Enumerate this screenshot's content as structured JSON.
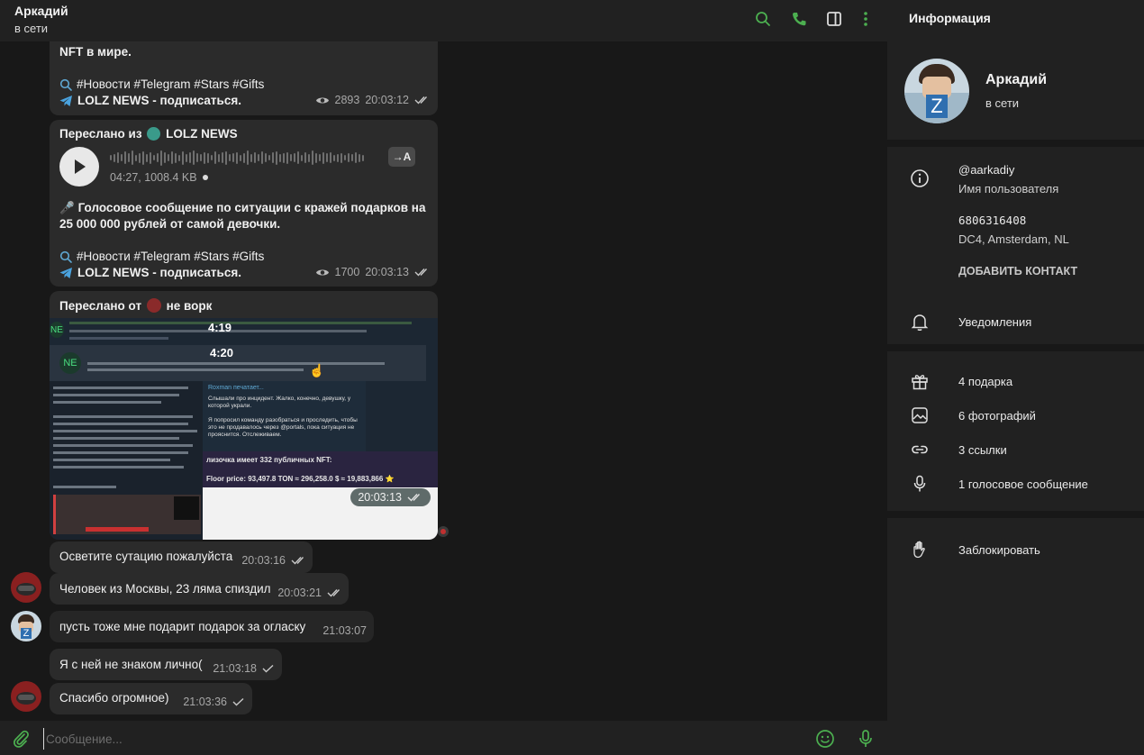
{
  "header": {
    "name": "Аркадий",
    "status": "в сети",
    "icons": [
      "search-icon",
      "phone-icon",
      "sidebar-toggle-icon",
      "more-vertical-icon"
    ]
  },
  "messages": {
    "m1": {
      "text_top": "NFT в мире.",
      "hashtags": "#Новости #Telegram #Stars #Gifts",
      "link": "LOLZ NEWS - подписаться.",
      "views": "2893",
      "time": "20:03:12"
    },
    "m2": {
      "forward_prefix": "Переслано из",
      "forward_source": "LOLZ NEWS",
      "voice_meta": "04:27, 1008.4 KB",
      "transcribe": "→A",
      "text_line1": "Голосовое сообщение по ситуации с кражей подарков на",
      "text_line2": "25 000 000 рублей от самой девочки.",
      "hashtags": "#Новости #Telegram #Stars #Gifts",
      "link": "LOLZ NEWS - подписаться.",
      "views": "1700",
      "time": "20:03:13"
    },
    "m3": {
      "forward_prefix": "Переслано от",
      "forward_source": "не ворк",
      "time": "20:03:13",
      "image": {
        "time1": "4:19",
        "time2": "4:20",
        "card_title": "Roxman печатает...",
        "card_body1": "Слышали про инцидент. Жалко, конечно, девушку, у которой украли.",
        "card_body2": "Я попросил команду разобраться и проследить, чтобы это не продавалось через @portals, пока ситуация не прояснится. Отслеживаем.",
        "nft_line1": "лизочка имеет 332 публичных NFT:",
        "nft_line2": "Floor price: 93,497.8 TON ≈ 296,258.0 $ ≈ 19,883,866 ⭐"
      }
    },
    "m4": {
      "text": "Осветите сутацию пожалуйста",
      "time": "20:03:16"
    },
    "m5": {
      "text": "Человек из Москвы, 23 ляма спиздил",
      "time": "20:03:21"
    },
    "m6": {
      "text": "пусть тоже  мне подарит подарок  за огласку",
      "time": "21:03:07"
    },
    "m7": {
      "text": "Я с ней не знаком лично(",
      "time": "21:03:18"
    },
    "m8": {
      "text": "Спасибо огромное)",
      "time": "21:03:36"
    }
  },
  "composer": {
    "placeholder": "Сообщение..."
  },
  "info": {
    "title": "Информация",
    "name": "Аркадий",
    "status": "в сети",
    "username": "@aarkadiy",
    "username_label": "Имя пользователя",
    "user_id": "6806316408",
    "dc": "DC4, Amsterdam, NL",
    "add_contact": "ДОБАВИТЬ КОНТАКТ",
    "notifications": "Уведомления",
    "gifts": "4 подарка",
    "photos": "6 фотографий",
    "links": "3 ссылки",
    "voice": "1 голосовое сообщение",
    "block": "Заблокировать"
  },
  "colors": {
    "accent": "#4caf50",
    "bubble": "#2b2b2b",
    "panel": "#212121",
    "background": "#181818",
    "link": "#5fa8d3"
  }
}
